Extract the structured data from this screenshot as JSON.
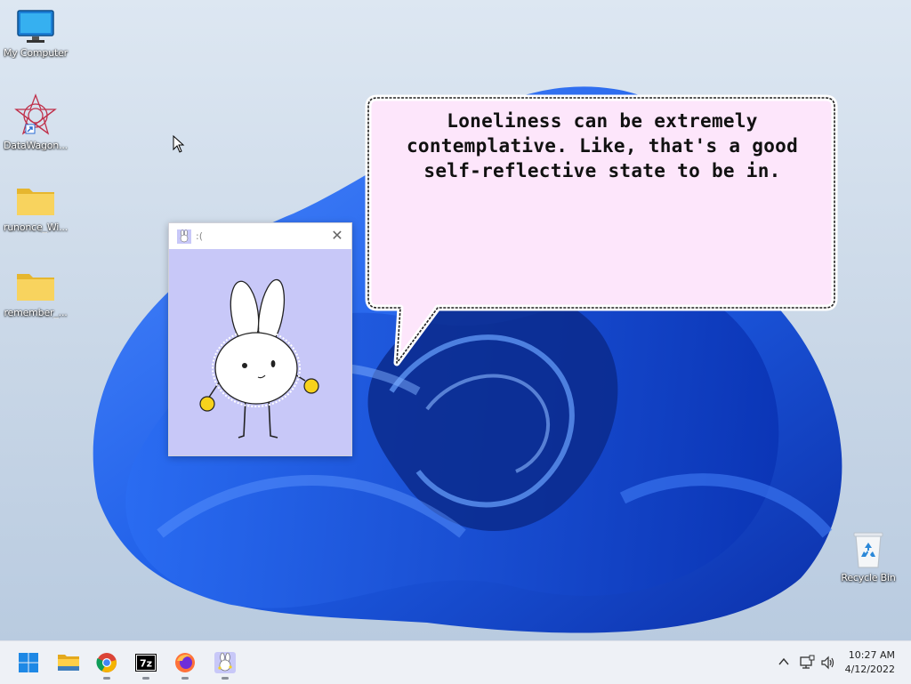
{
  "desktop_icons": [
    {
      "label": "My Computer",
      "icon": "monitor-icon"
    },
    {
      "label": "DataWagon...",
      "icon": "datawagon-icon"
    },
    {
      "label": "runonce_Wi...",
      "icon": "folder-icon"
    },
    {
      "label": "remember_...",
      "icon": "folder-icon"
    },
    {
      "label": "Recycle Bin",
      "icon": "recycle-bin-icon"
    }
  ],
  "pet_window": {
    "title": ":(",
    "close_glyph": "✕"
  },
  "speech_bubble": {
    "text": "Loneliness can be extremely contemplative. Like, that's a good self-reflective state to be in."
  },
  "taskbar": {
    "apps": [
      "start-icon",
      "file-explorer-icon",
      "chrome-icon",
      "7zip-icon",
      "firefox-icon",
      "bunny-app-icon"
    ],
    "clock": {
      "time": "10:27 AM",
      "date": "4/12/2022"
    }
  },
  "colors": {
    "bubble_fill": "#fde6fb",
    "pet_background": "#c8c8f8",
    "wallpaper_blue": "#1a5fe0"
  }
}
